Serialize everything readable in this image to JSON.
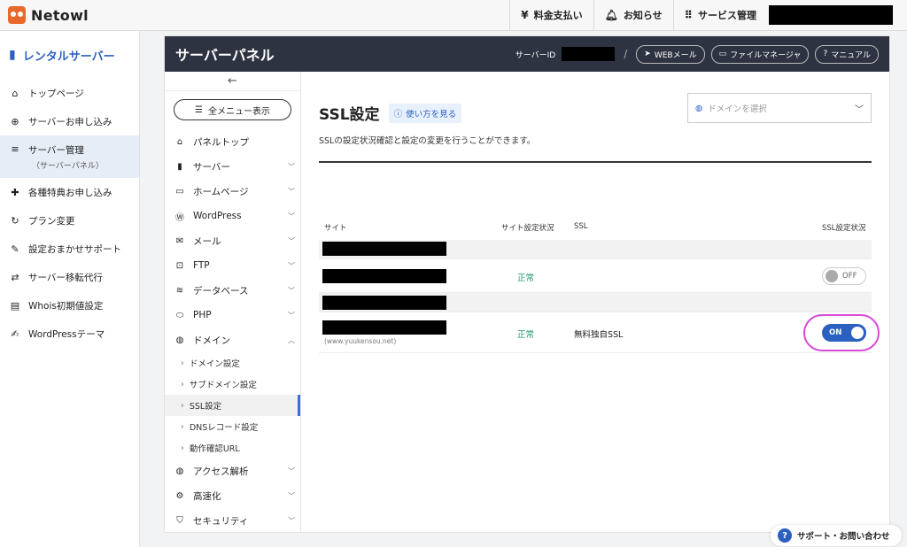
{
  "app": {
    "brand": "Netowl"
  },
  "topbar": {
    "actions": [
      {
        "icon": "yen-icon",
        "label": "料金支払い"
      },
      {
        "icon": "bell-icon",
        "label": "お知らせ"
      },
      {
        "icon": "grid-icon",
        "label": "サービス管理"
      }
    ]
  },
  "sidebar": {
    "title": "レンタルサーバー",
    "items": [
      {
        "label": "トップページ"
      },
      {
        "label": "サーバーお申し込み"
      },
      {
        "label": "サーバー管理",
        "sub": "（サーバーパネル）"
      },
      {
        "label": "各種特典お申し込み"
      },
      {
        "label": "プラン変更"
      },
      {
        "label": "設定おまかせサポート"
      },
      {
        "label": "サーバー移転代行"
      },
      {
        "label": "Whois初期値設定"
      },
      {
        "label": "WordPressテーマ"
      }
    ]
  },
  "panel": {
    "title": "サーバーパネル",
    "server_id_label": "サーバーID",
    "slash": "/",
    "buttons": {
      "webmail": "WEBメール",
      "filemanager": "ファイルマネージャ",
      "manual": "マニュアル"
    }
  },
  "nav": {
    "back_arrow": "←",
    "menu_button": "全メニュー表示",
    "items": [
      {
        "label": "パネルトップ"
      },
      {
        "label": "サーバー"
      },
      {
        "label": "ホームページ"
      },
      {
        "label": "WordPress"
      },
      {
        "label": "メール"
      },
      {
        "label": "FTP"
      },
      {
        "label": "データベース"
      },
      {
        "label": "PHP"
      },
      {
        "label": "ドメイン"
      }
    ],
    "sub_items": [
      {
        "label": "ドメイン設定"
      },
      {
        "label": "サブドメイン設定"
      },
      {
        "label": "SSL設定"
      },
      {
        "label": "DNSレコード設定"
      },
      {
        "label": "動作確認URL"
      }
    ],
    "items_after": [
      {
        "label": "アクセス解析"
      },
      {
        "label": "高速化"
      },
      {
        "label": "セキュリティ"
      }
    ]
  },
  "content": {
    "title": "SSL設定",
    "howto": "使い方を見る",
    "domain_select_placeholder": "ドメインを選択",
    "description": "SSLの設定状況確認と設定の変更を行うことができます。",
    "table": {
      "headers": {
        "site": "サイト",
        "status": "サイト設定状況",
        "ssl": "SSL",
        "ssl_status": "SSL設定状況"
      },
      "rows": [
        {
          "status": "正常",
          "ssl": "",
          "toggle": "OFF"
        },
        {
          "url": "(www.yuukensou.net)",
          "status": "正常",
          "ssl": "無料独自SSL",
          "toggle": "ON"
        }
      ]
    }
  },
  "support": {
    "label": "サポート・お問い合わせ"
  },
  "colors": {
    "accent": "#2b5fc0",
    "ok": "#1f9a6c",
    "header_bg": "#2d3340",
    "highlight": "#d84ad8"
  }
}
